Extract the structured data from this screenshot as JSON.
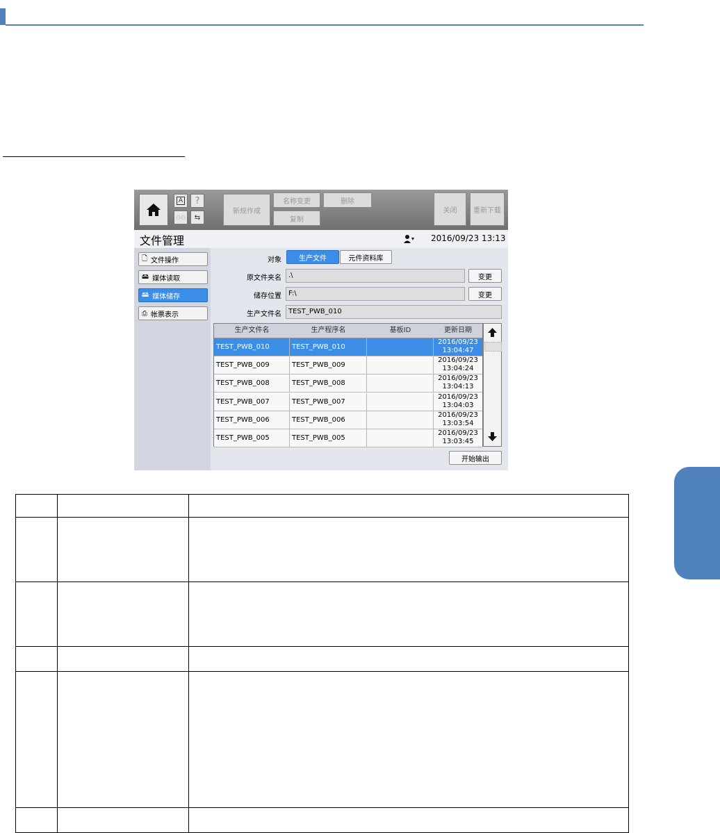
{
  "screen": {
    "toolbar": {
      "new_btn": "新规作成",
      "rename_btn": "名称变更",
      "delete_btn": "删除",
      "copy_btn": "复制",
      "close_btn": "关闭",
      "reload_btn": "重新下载"
    },
    "title": "文件管理",
    "datetime": "2016/09/23 13:13",
    "nav": [
      {
        "label": "文件操作",
        "icon": "file-search-icon",
        "active": false
      },
      {
        "label": "媒体读取",
        "icon": "media-read-icon",
        "active": false
      },
      {
        "label": "媒体储存",
        "icon": "media-save-icon",
        "active": true
      },
      {
        "label": "帐票表示",
        "icon": "printer-icon",
        "active": false
      }
    ],
    "form": {
      "target_label": "对象",
      "target_opt1": "生产文件",
      "target_opt2": "元件资料库",
      "src_label": "原文件夹名",
      "src_value": ".\\",
      "dest_label": "储存位置",
      "dest_value": "F:\\",
      "file_label": "生产文件名",
      "file_value": "TEST_PWB_010",
      "change_btn": "变更"
    },
    "grid": {
      "headers": [
        "生产文件名",
        "生产程序名",
        "基板ID",
        "更新日期"
      ],
      "rows": [
        {
          "file": "TEST_PWB_010",
          "program": "TEST_PWB_010",
          "board": "",
          "date": "2016/09/23",
          "time": "13:04:47",
          "selected": true
        },
        {
          "file": "TEST_PWB_009",
          "program": "TEST_PWB_009",
          "board": "",
          "date": "2016/09/23",
          "time": "13:04:24",
          "selected": false
        },
        {
          "file": "TEST_PWB_008",
          "program": "TEST_PWB_008",
          "board": "",
          "date": "2016/09/23",
          "time": "13:04:13",
          "selected": false
        },
        {
          "file": "TEST_PWB_007",
          "program": "TEST_PWB_007",
          "board": "",
          "date": "2016/09/23",
          "time": "13:04:03",
          "selected": false
        },
        {
          "file": "TEST_PWB_006",
          "program": "TEST_PWB_006",
          "board": "",
          "date": "2016/09/23",
          "time": "13:03:54",
          "selected": false
        },
        {
          "file": "TEST_PWB_005",
          "program": "TEST_PWB_005",
          "board": "",
          "date": "2016/09/23",
          "time": "13:03:45",
          "selected": false
        }
      ]
    },
    "start_btn": "开始输出"
  },
  "colors": {
    "accent": "#4f81bd",
    "selected": "#3a8ee8"
  }
}
